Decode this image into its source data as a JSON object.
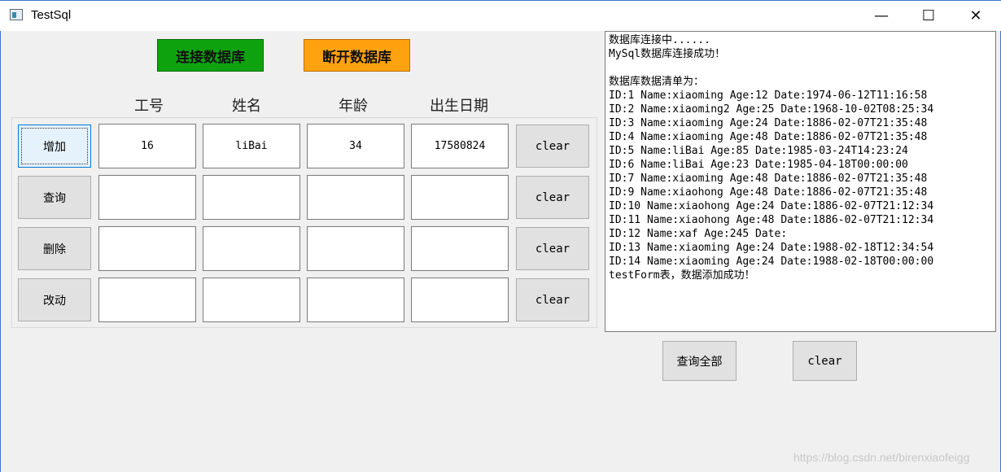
{
  "window": {
    "title": "TestSql",
    "minimize_glyph": "—",
    "maximize_glyph": "☐",
    "close_glyph": "✕"
  },
  "toolbar": {
    "connect_label": "连接数据库",
    "disconnect_label": "断开数据库"
  },
  "colors": {
    "connect_button": "#0ea30e",
    "disconnect_button": "#ffa20f"
  },
  "columns": [
    "工号",
    "姓名",
    "年龄",
    "出生日期"
  ],
  "rows": [
    {
      "action": "增加",
      "values": [
        "16",
        "liBai",
        "34",
        "17580824"
      ],
      "clear": "clear"
    },
    {
      "action": "查询",
      "values": [
        "",
        "",
        "",
        ""
      ],
      "clear": "clear"
    },
    {
      "action": "删除",
      "values": [
        "",
        "",
        "",
        ""
      ],
      "clear": "clear"
    },
    {
      "action": "改动",
      "values": [
        "",
        "",
        "",
        ""
      ],
      "clear": "clear"
    }
  ],
  "log": [
    "数据库连接中......",
    "MySql数据库连接成功！",
    "",
    "数据库数据清单为：",
    "ID:1 Name:xiaoming Age:12 Date:1974-06-12T11:16:58",
    "ID:2 Name:xiaoming2 Age:25 Date:1968-10-02T08:25:34",
    "ID:3 Name:xiaoming Age:24 Date:1886-02-07T21:35:48",
    "ID:4 Name:xiaoming Age:48 Date:1886-02-07T21:35:48",
    "ID:5 Name:liBai Age:85 Date:1985-03-24T14:23:24",
    "ID:6 Name:liBai Age:23 Date:1985-04-18T00:00:00",
    "ID:7 Name:xiaoming Age:48 Date:1886-02-07T21:35:48",
    "ID:9 Name:xiaohong Age:48 Date:1886-02-07T21:35:48",
    "ID:10 Name:xiaohong Age:24 Date:1886-02-07T21:12:34",
    "ID:11 Name:xiaohong Age:48 Date:1886-02-07T21:12:34",
    "ID:12 Name:xaf Age:245 Date:",
    "ID:13 Name:xiaoming Age:24 Date:1988-02-18T12:34:54",
    "ID:14 Name:xiaoming Age:24 Date:1988-02-18T00:00:00",
    "testForm表，数据添加成功！"
  ],
  "bottom": {
    "query_all_label": "查询全部",
    "clear_label": "clear"
  },
  "watermark": "https://blog.csdn.net/birenxiaofeigg"
}
